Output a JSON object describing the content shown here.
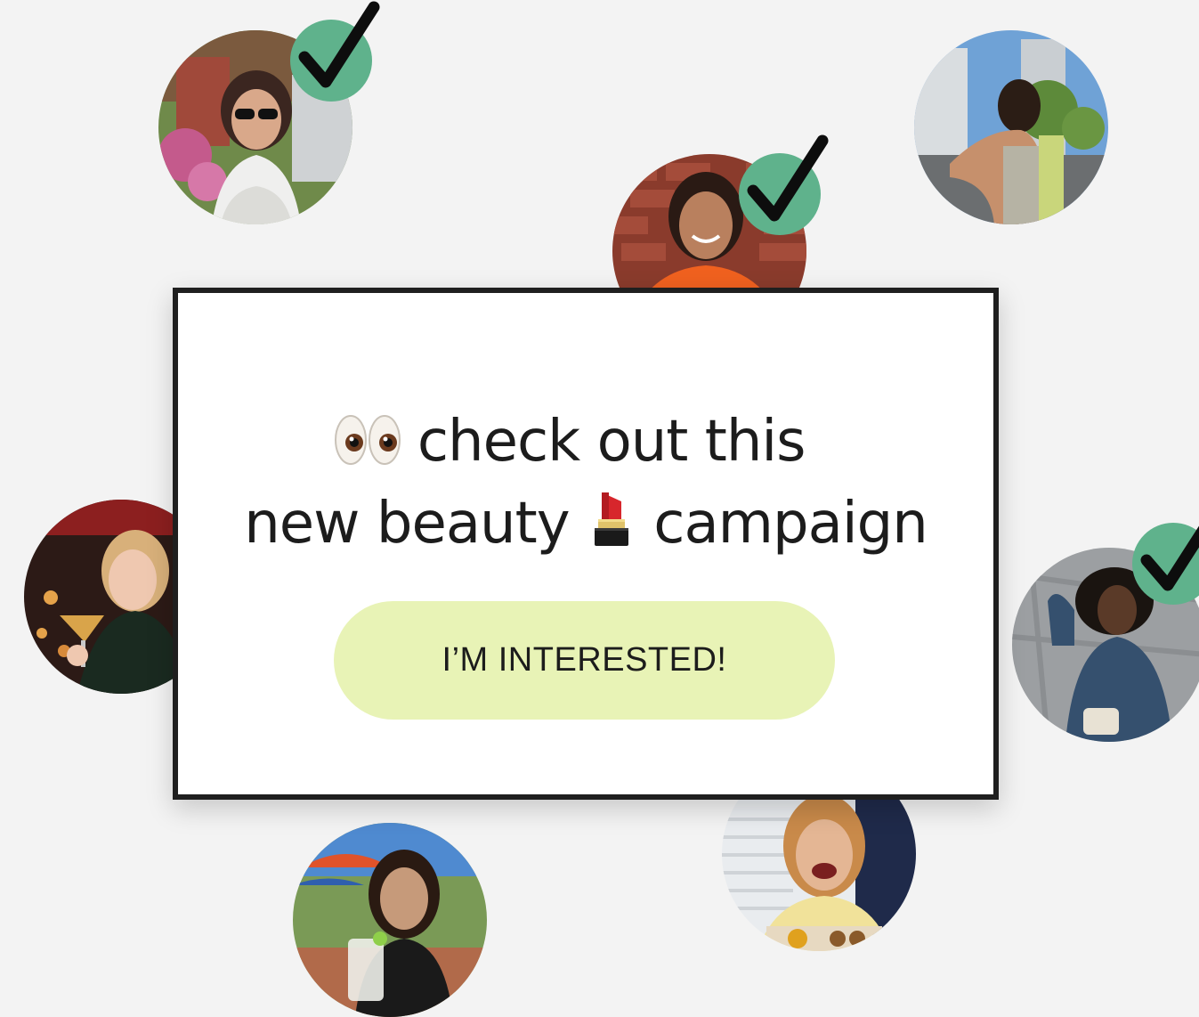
{
  "modal": {
    "headline_line1": "check out this",
    "headline_line2_a": "new beauty",
    "headline_line2_b": "campaign",
    "cta_label": "I’M INTERESTED!"
  },
  "icons": {
    "eyes": "eyes-emoji",
    "lipstick": "lipstick-emoji",
    "check": "checkmark-icon"
  },
  "colors": {
    "background": "#f3f3f3",
    "cta_background": "#e8f3b6",
    "check_badge": "#5fb28c",
    "text": "#1c1c1c"
  },
  "creators": [
    {
      "label": "creator-1",
      "selected": true
    },
    {
      "label": "creator-2",
      "selected": true
    },
    {
      "label": "creator-3",
      "selected": false
    },
    {
      "label": "creator-4",
      "selected": false
    },
    {
      "label": "creator-5",
      "selected": true
    },
    {
      "label": "creator-6",
      "selected": false
    },
    {
      "label": "creator-7",
      "selected": false
    }
  ]
}
